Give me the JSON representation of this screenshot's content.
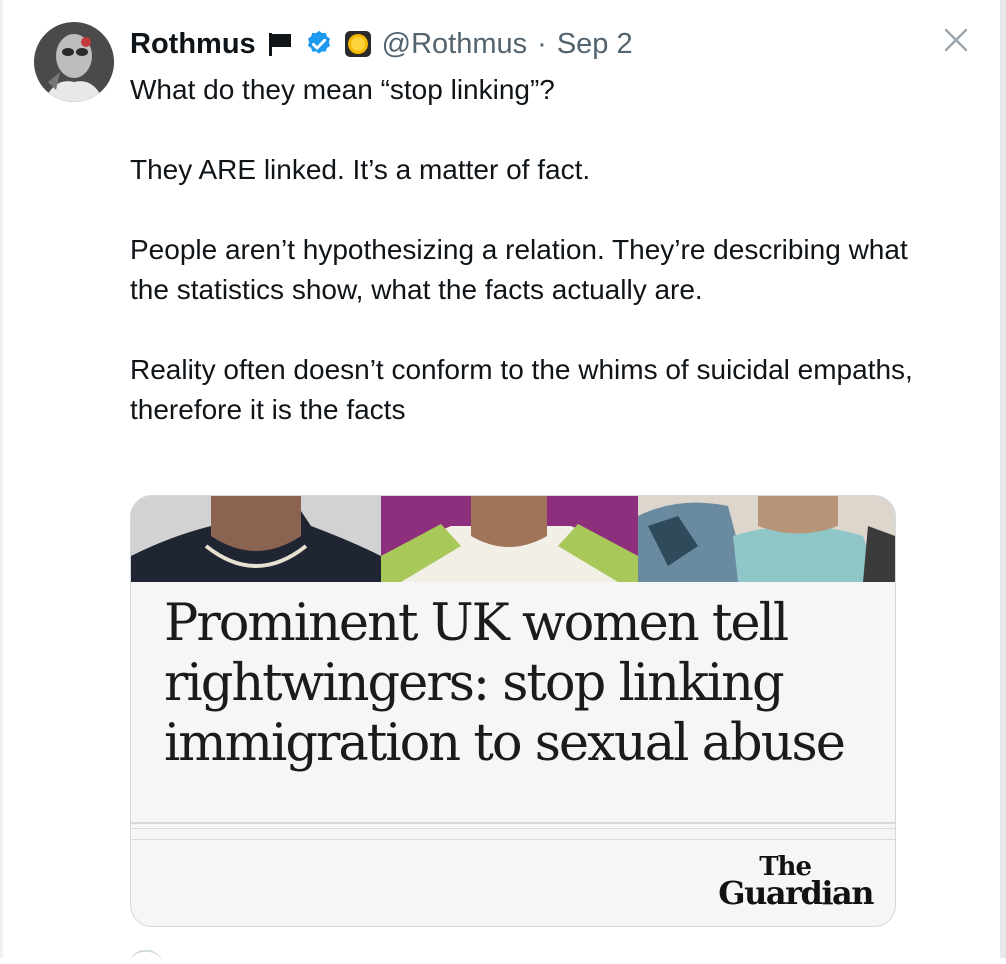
{
  "tweet": {
    "display_name": "Rothmus",
    "handle": "@Rothmus",
    "separator": "·",
    "date": "Sep 2",
    "text": [
      "What do they mean “stop linking”?",
      "They ARE linked. It’s a matter of fact.",
      "People aren’t hypothesizing a relation. They’re describing what the statistics show, what the facts actually are.",
      "Reality often doesn’t conform to the whims of suicidal empaths, therefore it is the facts"
    ]
  },
  "card": {
    "headline": "Prominent UK women tell rightwingers: stop linking immigration to sexual abuse",
    "logo_the": "The",
    "logo_guardian": "Guardian"
  },
  "icons": {
    "flag": "flag-icon",
    "verified": "verified-badge-icon",
    "coin": "coin-icon",
    "close": "close-icon"
  },
  "colors": {
    "verified_blue": "#1d9bf0",
    "muted_text": "#536471",
    "primary_text": "#0f1419",
    "card_border": "#cfd9de"
  }
}
